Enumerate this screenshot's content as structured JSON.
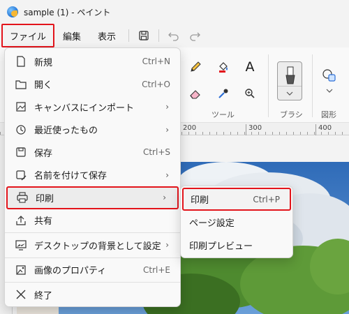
{
  "titlebar": {
    "title": "sample (1) - ペイント",
    "app_icon": "paint-icon"
  },
  "menubar": {
    "file": "ファイル",
    "edit": "編集",
    "view": "表示",
    "save_icon": "save-icon",
    "undo_icon": "undo-icon",
    "redo_icon": "redo-icon"
  },
  "ribbon": {
    "tools_label": "ツール",
    "brush_label": "ブラシ",
    "shapes_label": "図形",
    "tools": [
      "pencil-icon",
      "fill-icon",
      "text-icon",
      "eraser-icon",
      "color-picker-icon",
      "magnifier-icon"
    ]
  },
  "ruler": {
    "ticks": [
      "200",
      "300",
      "400"
    ]
  },
  "file_menu": {
    "items": [
      {
        "label": "新規",
        "shortcut": "Ctrl+N",
        "icon": "new-file-icon"
      },
      {
        "label": "開く",
        "shortcut": "Ctrl+O",
        "icon": "open-folder-icon"
      },
      {
        "label": "キャンバスにインポート",
        "submenu": true,
        "icon": "import-image-icon"
      },
      {
        "label": "最近使ったもの",
        "submenu": true,
        "icon": "recent-clock-icon"
      },
      {
        "label": "保存",
        "shortcut": "Ctrl+S",
        "icon": "save-icon"
      },
      {
        "label": "名前を付けて保存",
        "submenu": true,
        "icon": "save-as-icon"
      },
      {
        "label": "印刷",
        "submenu": true,
        "icon": "printer-icon",
        "highlighted": true
      },
      {
        "label": "共有",
        "icon": "share-icon"
      },
      {
        "label": "デスクトップの背景として設定",
        "submenu": true,
        "icon": "desktop-background-icon"
      },
      {
        "label": "画像のプロパティ",
        "shortcut": "Ctrl+E",
        "icon": "image-properties-icon"
      },
      {
        "label": "終了",
        "icon": "close-icon"
      }
    ]
  },
  "print_submenu": {
    "items": [
      {
        "label": "印刷",
        "shortcut": "Ctrl+P",
        "highlighted": true
      },
      {
        "label": "ページ設定"
      },
      {
        "label": "印刷プレビュー"
      }
    ]
  },
  "colors": {
    "highlight": "#e3141b",
    "menu_bg": "#f9f9f9",
    "sky": "#3f7bc4"
  }
}
